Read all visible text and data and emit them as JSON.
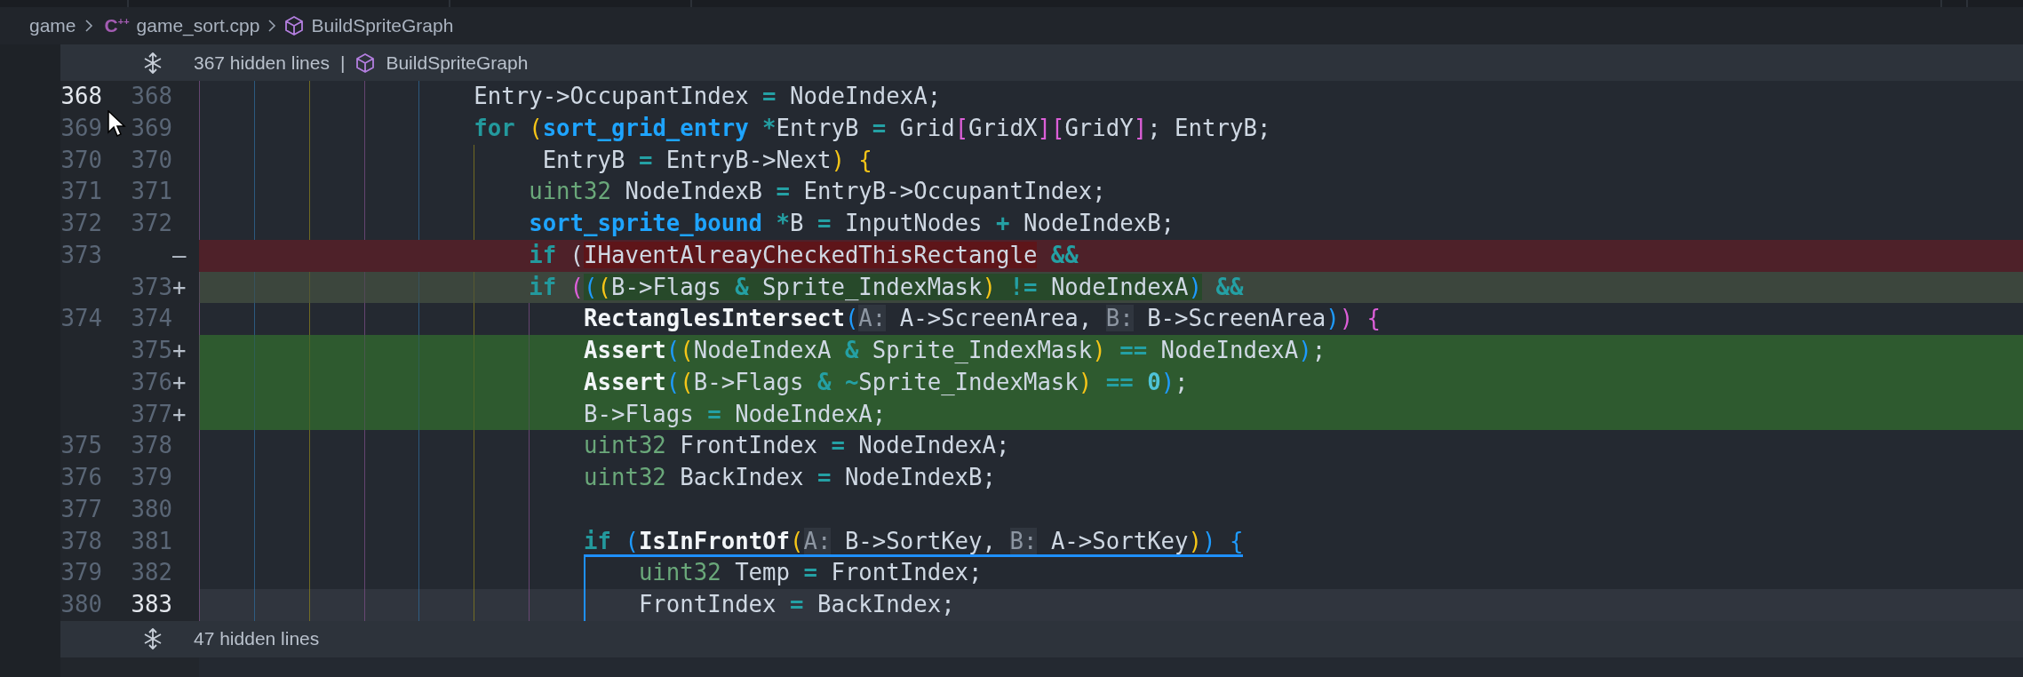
{
  "breadcrumb": [
    {
      "kind": "folder",
      "label": "game"
    },
    {
      "kind": "file",
      "icon_text": "C$^{++}$",
      "label": "game_sort.cpp"
    },
    {
      "kind": "symbol",
      "label": "BuildSpriteGraph"
    }
  ],
  "hidden_before": {
    "count_label": "367 hidden lines",
    "separator": "|",
    "symbol": "BuildSpriteGraph"
  },
  "lines": [
    {
      "kind": "context",
      "old_number": "368",
      "new_number": "368",
      "old_active": true,
      "new_active": false,
      "current": false,
      "scope_start": false,
      "scope_inside": false,
      "tokens": [
        {
          "text": "                    Entry->OccupantIndex ",
          "kind": "plain"
        },
        {
          "text": "=",
          "kind": "op"
        },
        {
          "text": " NodeIndexA;",
          "kind": "plain"
        }
      ]
    },
    {
      "kind": "context",
      "old_number": "369",
      "new_number": "369",
      "old_active": false,
      "new_active": false,
      "current": false,
      "scope_start": false,
      "scope_inside": false,
      "tokens": [
        {
          "text": "                    for ",
          "kind": "kw"
        },
        {
          "text": "(",
          "kind": "b1"
        },
        {
          "text": "sort_grid_entry ",
          "kind": "type"
        },
        {
          "text": "*",
          "kind": "op"
        },
        {
          "text": "EntryB ",
          "kind": "plain"
        },
        {
          "text": "=",
          "kind": "op"
        },
        {
          "text": " Grid",
          "kind": "plain"
        },
        {
          "text": "[",
          "kind": "b3"
        },
        {
          "text": "GridX",
          "kind": "plain"
        },
        {
          "text": "]",
          "kind": "b3"
        },
        {
          "text": "[",
          "kind": "b3"
        },
        {
          "text": "GridY",
          "kind": "plain"
        },
        {
          "text": "]",
          "kind": "b3"
        },
        {
          "text": "; EntryB;",
          "kind": "plain"
        }
      ]
    },
    {
      "kind": "context",
      "old_number": "370",
      "new_number": "370",
      "old_active": false,
      "new_active": false,
      "current": false,
      "scope_start": false,
      "scope_inside": false,
      "tokens": [
        {
          "text": "                         EntryB ",
          "kind": "plain"
        },
        {
          "text": "=",
          "kind": "op"
        },
        {
          "text": " EntryB->Next",
          "kind": "plain"
        },
        {
          "text": ")",
          "kind": "b1"
        },
        {
          "text": " {",
          "kind": "b1"
        }
      ]
    },
    {
      "kind": "context",
      "old_number": "371",
      "new_number": "371",
      "old_active": false,
      "new_active": false,
      "current": false,
      "scope_start": false,
      "scope_inside": false,
      "tokens": [
        {
          "text": "                        uint32",
          "kind": "prim"
        },
        {
          "text": " NodeIndexB ",
          "kind": "plain"
        },
        {
          "text": "=",
          "kind": "op"
        },
        {
          "text": " EntryB->OccupantIndex;",
          "kind": "plain"
        }
      ]
    },
    {
      "kind": "context",
      "old_number": "372",
      "new_number": "372",
      "old_active": false,
      "new_active": false,
      "current": false,
      "scope_start": false,
      "scope_inside": false,
      "tokens": [
        {
          "text": "                        sort_sprite_bound ",
          "kind": "type"
        },
        {
          "text": "*",
          "kind": "op"
        },
        {
          "text": "B ",
          "kind": "plain"
        },
        {
          "text": "=",
          "kind": "op"
        },
        {
          "text": " InputNodes ",
          "kind": "plain"
        },
        {
          "text": "+",
          "kind": "op"
        },
        {
          "text": " NodeIndexB;",
          "kind": "plain"
        }
      ]
    },
    {
      "kind": "deleted",
      "old_number": "373",
      "marker": "—",
      "old_active": false,
      "current": false,
      "scope_start": false,
      "scope_inside": false,
      "tokens": [
        {
          "text": "                        if ",
          "kind": "kw",
          "changed": false
        },
        {
          "text": "(",
          "kind": "plain",
          "changed": false
        },
        {
          "text": "IHaventAlreayCheckedThisRectangle",
          "kind": "plain",
          "changed": true
        },
        {
          "text": " &&",
          "kind": "op",
          "changed": false
        }
      ]
    },
    {
      "kind": "modified",
      "new_number": "373",
      "marker": "+",
      "new_active": false,
      "current": false,
      "scope_start": false,
      "scope_inside": false,
      "tokens": [
        {
          "text": "                        if ",
          "kind": "kw",
          "changed": false
        },
        {
          "text": "(",
          "kind": "b3",
          "changed": false
        },
        {
          "text": "(",
          "kind": "b2",
          "changed": true
        },
        {
          "text": "(",
          "kind": "b1",
          "changed": true
        },
        {
          "text": "B->Flags ",
          "kind": "plain",
          "changed": true
        },
        {
          "text": "&",
          "kind": "op",
          "changed": true
        },
        {
          "text": " Sprite_IndexMask",
          "kind": "plain",
          "changed": true
        },
        {
          "text": ")",
          "kind": "b1",
          "changed": true
        },
        {
          "text": " !=",
          "kind": "op",
          "changed": true
        },
        {
          "text": " NodeIndexA",
          "kind": "plain",
          "changed": true
        },
        {
          "text": ")",
          "kind": "b2",
          "changed": true
        },
        {
          "text": " &&",
          "kind": "op",
          "changed": false
        }
      ]
    },
    {
      "kind": "context",
      "old_number": "374",
      "new_number": "374",
      "old_active": false,
      "new_active": false,
      "current": false,
      "scope_start": false,
      "scope_inside": false,
      "tokens": [
        {
          "text": "                            RectanglesIntersect",
          "kind": "fn"
        },
        {
          "text": "(",
          "kind": "b2"
        },
        {
          "text": "A:",
          "kind": "hint"
        },
        {
          "text": " A->ScreenArea, ",
          "kind": "plain"
        },
        {
          "text": "B:",
          "kind": "hint"
        },
        {
          "text": " B->ScreenArea",
          "kind": "plain"
        },
        {
          "text": ")",
          "kind": "b2"
        },
        {
          "text": ")",
          "kind": "b3"
        },
        {
          "text": " {",
          "kind": "b3"
        }
      ]
    },
    {
      "kind": "added",
      "new_number": "375",
      "marker": "+",
      "new_active": false,
      "current": false,
      "scope_start": false,
      "scope_inside": false,
      "tokens": [
        {
          "text": "                            Assert",
          "kind": "fn"
        },
        {
          "text": "(",
          "kind": "b2"
        },
        {
          "text": "(",
          "kind": "b1"
        },
        {
          "text": "NodeIndexA ",
          "kind": "plain"
        },
        {
          "text": "&",
          "kind": "op"
        },
        {
          "text": " Sprite_IndexMask",
          "kind": "plain"
        },
        {
          "text": ")",
          "kind": "b1"
        },
        {
          "text": " ==",
          "kind": "op"
        },
        {
          "text": " NodeIndexA",
          "kind": "plain"
        },
        {
          "text": ")",
          "kind": "b2"
        },
        {
          "text": ";",
          "kind": "plain"
        }
      ]
    },
    {
      "kind": "added",
      "new_number": "376",
      "marker": "+",
      "new_active": false,
      "current": false,
      "scope_start": false,
      "scope_inside": false,
      "tokens": [
        {
          "text": "                            Assert",
          "kind": "fn"
        },
        {
          "text": "(",
          "kind": "b2"
        },
        {
          "text": "(",
          "kind": "b1"
        },
        {
          "text": "B->Flags ",
          "kind": "plain"
        },
        {
          "text": "&",
          "kind": "op"
        },
        {
          "text": " ~",
          "kind": "op"
        },
        {
          "text": "Sprite_IndexMask",
          "kind": "plain"
        },
        {
          "text": ")",
          "kind": "b1"
        },
        {
          "text": " ==",
          "kind": "op"
        },
        {
          "text": " 0",
          "kind": "num"
        },
        {
          "text": ")",
          "kind": "b2"
        },
        {
          "text": ";",
          "kind": "plain"
        }
      ]
    },
    {
      "kind": "added",
      "new_number": "377",
      "marker": "+",
      "new_active": false,
      "current": false,
      "scope_start": false,
      "scope_inside": false,
      "tokens": [
        {
          "text": "                            B->Flags ",
          "kind": "plain"
        },
        {
          "text": "=",
          "kind": "op"
        },
        {
          "text": " NodeIndexA;",
          "kind": "plain"
        }
      ]
    },
    {
      "kind": "context",
      "old_number": "375",
      "new_number": "378",
      "old_active": false,
      "new_active": false,
      "current": false,
      "scope_start": false,
      "scope_inside": false,
      "tokens": [
        {
          "text": "                            uint32",
          "kind": "prim"
        },
        {
          "text": " FrontIndex ",
          "kind": "plain"
        },
        {
          "text": "=",
          "kind": "op"
        },
        {
          "text": " NodeIndexA;",
          "kind": "plain"
        }
      ]
    },
    {
      "kind": "context",
      "old_number": "376",
      "new_number": "379",
      "old_active": false,
      "new_active": false,
      "current": false,
      "scope_start": false,
      "scope_inside": false,
      "tokens": [
        {
          "text": "                            uint32",
          "kind": "prim"
        },
        {
          "text": " BackIndex ",
          "kind": "plain"
        },
        {
          "text": "=",
          "kind": "op"
        },
        {
          "text": " NodeIndexB;",
          "kind": "plain"
        }
      ]
    },
    {
      "kind": "context",
      "old_number": "377",
      "new_number": "380",
      "old_active": false,
      "new_active": false,
      "current": false,
      "scope_start": false,
      "scope_inside": false
    },
    {
      "kind": "context",
      "old_number": "378",
      "new_number": "381",
      "old_active": false,
      "new_active": false,
      "current": false,
      "scope_start": true,
      "scope_inside": false,
      "tokens": [
        {
          "text": "                            if ",
          "kind": "kw"
        },
        {
          "text": "(",
          "kind": "b2"
        },
        {
          "text": "IsInFrontOf",
          "kind": "fn"
        },
        {
          "text": "(",
          "kind": "b1"
        },
        {
          "text": "A:",
          "kind": "hint"
        },
        {
          "text": " B->SortKey, ",
          "kind": "plain"
        },
        {
          "text": "B:",
          "kind": "hint"
        },
        {
          "text": " A->SortKey",
          "kind": "plain"
        },
        {
          "text": ")",
          "kind": "b1"
        },
        {
          "text": ")",
          "kind": "b2"
        },
        {
          "text": " {",
          "kind": "b2"
        }
      ]
    },
    {
      "kind": "context",
      "old_number": "379",
      "new_number": "382",
      "old_active": false,
      "new_active": false,
      "current": false,
      "scope_start": false,
      "scope_inside": true,
      "tokens": [
        {
          "text": "                                uint32",
          "kind": "prim"
        },
        {
          "text": " Temp ",
          "kind": "plain"
        },
        {
          "text": "=",
          "kind": "op"
        },
        {
          "text": " FrontIndex;",
          "kind": "plain"
        }
      ]
    },
    {
      "kind": "context",
      "old_number": "380",
      "new_number": "383",
      "old_active": false,
      "new_active": true,
      "current": true,
      "scope_start": false,
      "scope_inside": true,
      "tokens": [
        {
          "text": "                                FrontIndex ",
          "kind": "plain"
        },
        {
          "text": "=",
          "kind": "op"
        },
        {
          "text": " BackIndex;",
          "kind": "plain"
        }
      ]
    }
  ],
  "hidden_after": {
    "count_label": "47 hidden lines"
  }
}
